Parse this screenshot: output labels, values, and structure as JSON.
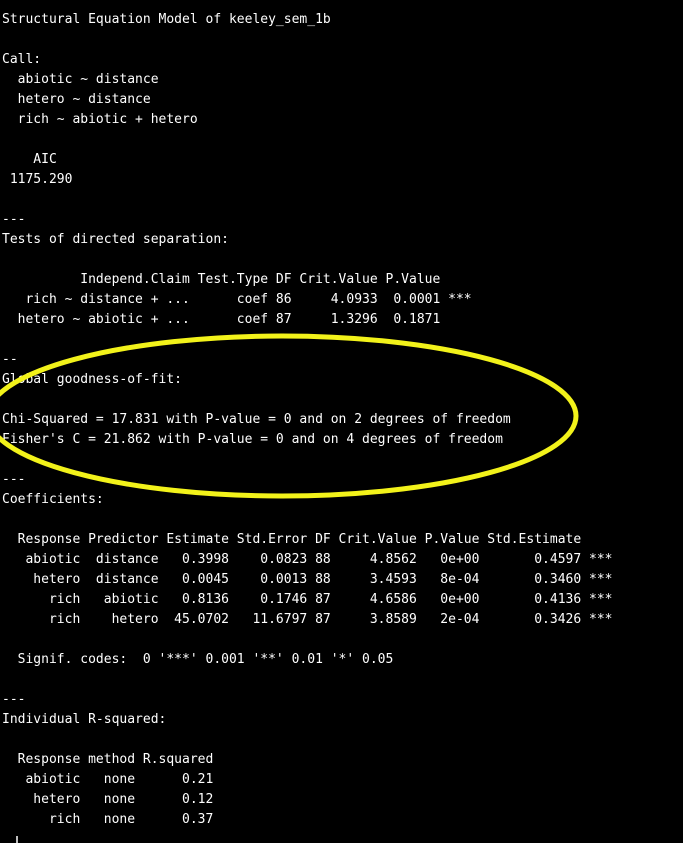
{
  "terminal": {
    "lines": [
      "Structural Equation Model of keeley_sem_1b",
      "",
      "Call:",
      "  abiotic ~ distance",
      "  hetero ~ distance",
      "  rich ~ abiotic + hetero",
      "",
      "    AIC",
      " 1175.290",
      "",
      "---",
      "Tests of directed separation:",
      "",
      "          Independ.Claim Test.Type DF Crit.Value P.Value     ",
      "   rich ~ distance + ...      coef 86     4.0933  0.0001 ***",
      "  hetero ~ abiotic + ...      coef 87     1.3296  0.1871    ",
      "",
      "--",
      "Global goodness-of-fit:",
      "",
      "Chi-Squared = 17.831 with P-value = 0 and on 2 degrees of freedom",
      "Fisher's C = 21.862 with P-value = 0 and on 4 degrees of freedom",
      "",
      "---",
      "Coefficients:",
      "",
      "  Response Predictor Estimate Std.Error DF Crit.Value P.Value Std.Estimate    ",
      "   abiotic  distance   0.3998    0.0823 88     4.8562   0e+00       0.4597 ***",
      "    hetero  distance   0.0045    0.0013 88     3.4593   8e-04       0.3460 ***",
      "      rich   abiotic   0.8136    0.1746 87     4.6586   0e+00       0.4136 ***",
      "      rich    hetero  45.0702   11.6797 87     3.8589   2e-04       0.3426 ***",
      "",
      "  Signif. codes:  0 '***' 0.001 '**' 0.01 '*' 0.05",
      "",
      "---",
      "Individual R-squared:",
      "",
      "  Response method R.squared",
      "   abiotic   none      0.21",
      "    hetero   none      0.12",
      "      rich   none      0.37"
    ]
  },
  "colors": {
    "background": "#000000",
    "text": "#ffffff",
    "highlight": "#ffff00"
  }
}
